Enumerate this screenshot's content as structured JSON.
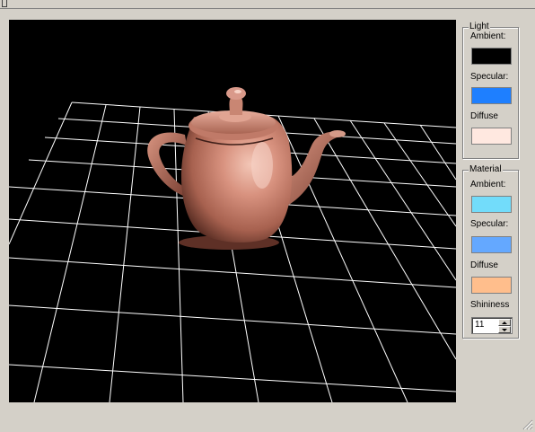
{
  "light": {
    "title": "Light",
    "ambient_label": "Ambient:",
    "ambient_color": "#000000",
    "specular_label": "Specular:",
    "specular_color": "#1e7fff",
    "diffuse_label": "Diffuse",
    "diffuse_color": "#ffe8e0"
  },
  "material": {
    "title": "Material",
    "ambient_label": "Ambient:",
    "ambient_color": "#72dcfa",
    "specular_label": "Specular:",
    "specular_color": "#64a8ff",
    "diffuse_label": "Diffuse",
    "diffuse_color": "#ffbe8c",
    "shininess_label": "Shininess",
    "shininess_value": "11"
  },
  "viewport": {
    "background": "#000000",
    "grid_color": "#ffffff",
    "teapot_color": "#d08c78"
  },
  "icons": {
    "spin_up": "spin-up-icon",
    "spin_down": "spin-down-icon",
    "resize_grip": "resize-grip-icon"
  }
}
